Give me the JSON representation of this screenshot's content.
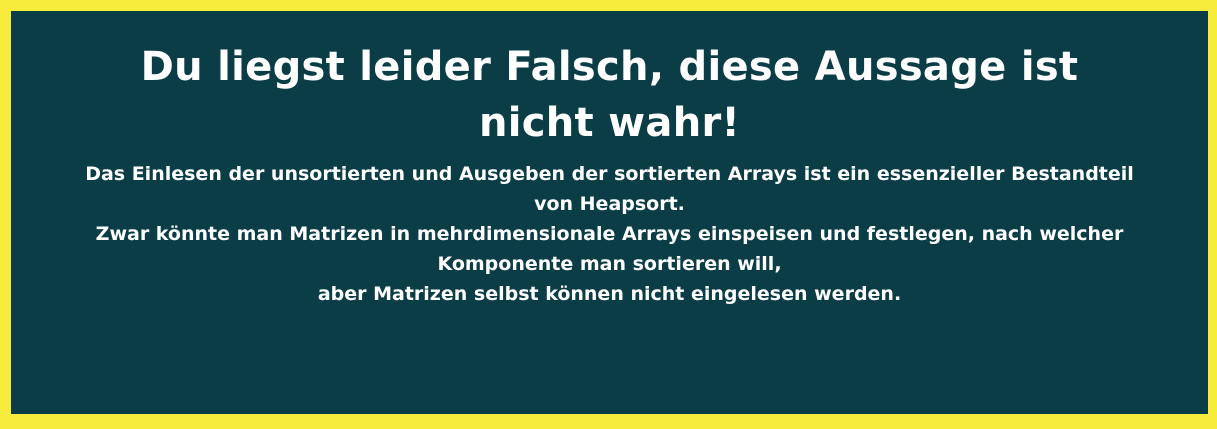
{
  "colors": {
    "border": "#f7ec3c",
    "panel_background": "#0b3d47",
    "text": "#ffffff"
  },
  "feedback": {
    "headline_lines": [
      "Du liegst leider Falsch, diese Aussage ist",
      "nicht wahr!"
    ],
    "explanation_lines": [
      "Das Einlesen der unsortierten und Ausgeben der sortierten Arrays ist ein essenzieller Bestandteil",
      "von Heapsort.",
      "Zwar könnte man Matrizen in mehrdimensionale Arrays einspeisen und festlegen, nach welcher",
      "Komponente man sortieren will,",
      "aber Matrizen selbst können nicht eingelesen werden."
    ]
  }
}
